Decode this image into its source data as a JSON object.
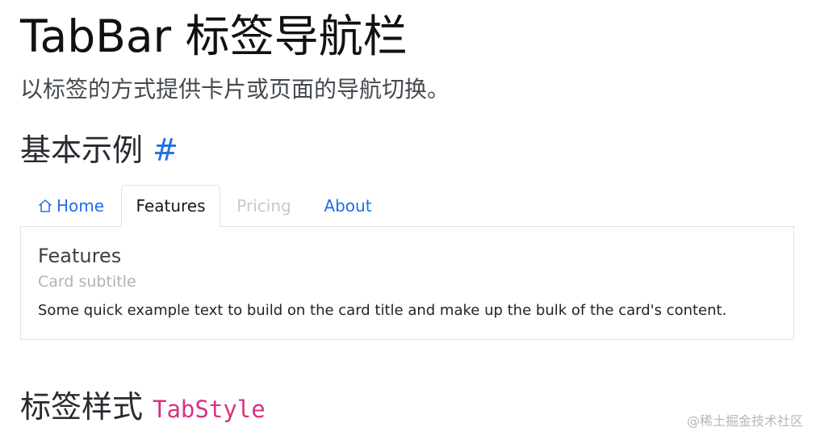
{
  "page": {
    "title": "TabBar 标签导航栏",
    "lead": "以标签的方式提供卡片或页面的导航切换。"
  },
  "sections": {
    "basic": {
      "heading": "基本示例",
      "anchor": "#"
    },
    "tab_style": {
      "heading": "标签样式",
      "code": "TabStyle"
    }
  },
  "tabbar": {
    "selected": "Features",
    "tabs": [
      {
        "label": "Home",
        "icon": "home-icon",
        "state": "link"
      },
      {
        "label": "Features",
        "state": "active"
      },
      {
        "label": "Pricing",
        "state": "disabled"
      },
      {
        "label": "About",
        "state": "link"
      }
    ]
  },
  "card": {
    "title": "Features",
    "subtitle": "Card subtitle",
    "text": "Some quick example text to build on the card title and make up the bulk of the card's content."
  },
  "watermark": "@稀土掘金技术社区",
  "colors": {
    "link": "#1f6fe5",
    "disabled": "#c5c9ce",
    "code": "#d63384",
    "border": "#dee2e6"
  }
}
